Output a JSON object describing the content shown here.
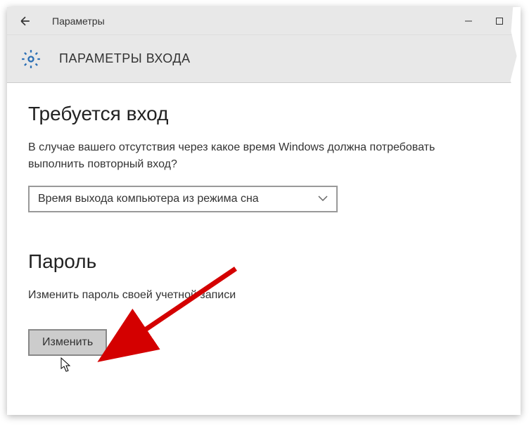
{
  "titlebar": {
    "title": "Параметры"
  },
  "subheader": {
    "title": "ПАРАМЕТРЫ ВХОДА"
  },
  "signin_section": {
    "title": "Требуется вход",
    "description": "В случае вашего отсутствия через какое время Windows должна потребовать выполнить повторный вход?",
    "dropdown_value": "Время выхода компьютера из режима сна"
  },
  "password_section": {
    "title": "Пароль",
    "description": "Изменить пароль своей учетной записи",
    "button_label": "Изменить"
  }
}
